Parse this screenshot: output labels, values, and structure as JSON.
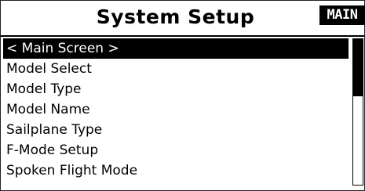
{
  "header": {
    "title": "System Setup",
    "badge": "MAIN"
  },
  "menu": {
    "items": [
      {
        "label": "< Main Screen >",
        "selected": true
      },
      {
        "label": "Model Select",
        "selected": false
      },
      {
        "label": "Model Type",
        "selected": false
      },
      {
        "label": "Model Name",
        "selected": false
      },
      {
        "label": "Sailplane Type",
        "selected": false
      },
      {
        "label": "F-Mode Setup",
        "selected": false
      },
      {
        "label": "Spoken Flight Mode",
        "selected": false
      }
    ]
  },
  "scroll": {
    "position_fraction": 0.0,
    "visible_fraction": 0.39
  },
  "colors": {
    "background": "#ffffff",
    "foreground": "#000000",
    "highlight_bg": "#000000",
    "highlight_fg": "#ffffff"
  }
}
